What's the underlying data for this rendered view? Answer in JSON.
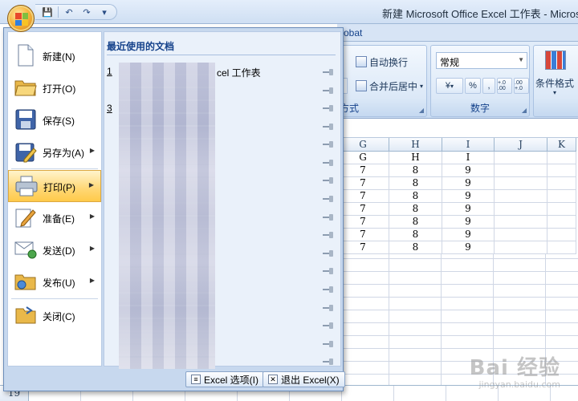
{
  "window": {
    "title": "新建 Microsoft Office Excel 工作表 - Microsoft"
  },
  "qat": {
    "save": "💾",
    "undo": "↶",
    "redo": "↷",
    "customize": "▾"
  },
  "ribbon": {
    "tab_partial": "robat",
    "wrap_text": "自动换行",
    "merge_center": "合并后居中",
    "align_group_partial": "方式",
    "number_format": "常规",
    "percent": "%",
    "comma": ",",
    "inc_decimal": "+.0 .00",
    "dec_decimal": ".00 +.0",
    "number_group": "数字",
    "conditional_format": "条件格式",
    "currency": "¥"
  },
  "grid": {
    "columns": [
      "G",
      "H",
      "I",
      "J",
      "K"
    ],
    "rows": [
      [
        "G",
        "H",
        "I",
        "",
        ""
      ],
      [
        "7",
        "8",
        "9",
        "",
        ""
      ],
      [
        "7",
        "8",
        "9",
        "",
        ""
      ],
      [
        "7",
        "8",
        "9",
        "",
        ""
      ],
      [
        "7",
        "8",
        "9",
        "",
        ""
      ],
      [
        "7",
        "8",
        "9",
        "",
        ""
      ],
      [
        "7",
        "8",
        "9",
        "",
        ""
      ],
      [
        "7",
        "8",
        "9",
        "",
        ""
      ]
    ],
    "row19": "19"
  },
  "menu": {
    "items": [
      {
        "label": "新建(N)",
        "icon": "new-document-icon",
        "has_arrow": false
      },
      {
        "label": "打开(O)",
        "icon": "open-folder-icon",
        "has_arrow": false
      },
      {
        "label": "保存(S)",
        "icon": "save-disk-icon",
        "has_arrow": false
      },
      {
        "label": "另存为(A)",
        "icon": "save-as-icon",
        "has_arrow": true
      },
      {
        "label": "打印(P)",
        "icon": "printer-icon",
        "has_arrow": true
      },
      {
        "label": "准备(E)",
        "icon": "prepare-pen-icon",
        "has_arrow": true
      },
      {
        "label": "发送(D)",
        "icon": "send-envelope-icon",
        "has_arrow": true
      },
      {
        "label": "发布(U)",
        "icon": "publish-folder-icon",
        "has_arrow": true
      },
      {
        "label": "关闭(C)",
        "icon": "close-folder-icon",
        "has_arrow": false
      }
    ],
    "recent_title": "最近使用的文档",
    "recent": [
      {
        "num": "1",
        "text": "cel 工作表"
      },
      {
        "num": "",
        "text": ""
      },
      {
        "num": "3",
        "text": ""
      }
    ],
    "excel_options": "Excel 选项(I)",
    "exit_excel": "退出 Excel(X)"
  },
  "watermark": {
    "main": "Bai 经验",
    "sub": "jingyan.baidu.com"
  }
}
